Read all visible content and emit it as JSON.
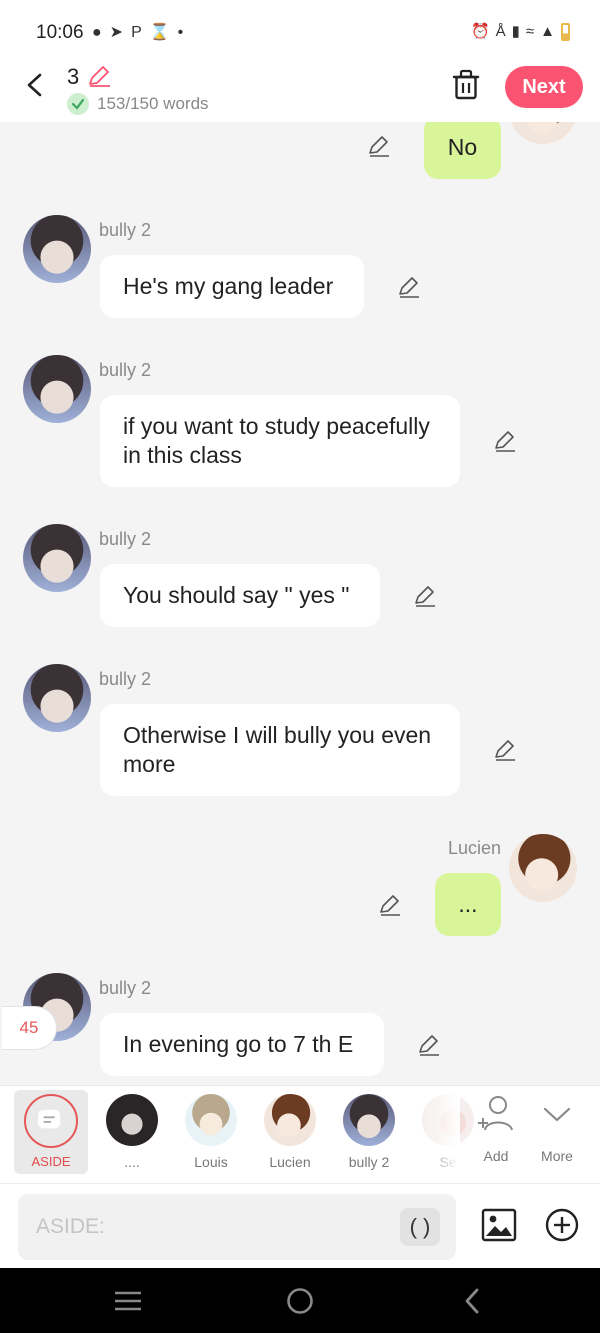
{
  "status_bar": {
    "time": "10:06",
    "left_icons": [
      "chat-bubble-icon",
      "telegram-icon",
      "P",
      "hourglass-icon",
      "dot-icon"
    ],
    "right_icons": [
      "alarm-icon",
      "bluetooth-icon",
      "volte-icon",
      "wifi-icon",
      "signal-icon",
      "battery-icon"
    ]
  },
  "header": {
    "chapter_number": "3",
    "word_count": "153/150 words",
    "next_label": "Next"
  },
  "messages": [
    {
      "sender": "",
      "text": "No",
      "side": "right"
    },
    {
      "sender": "bully 2",
      "text": "He's my gang leader",
      "side": "left"
    },
    {
      "sender": "bully 2",
      "text": "if you want to study peacefully in this class",
      "side": "left"
    },
    {
      "sender": "bully 2",
      "text": "You should say \" yes \"",
      "side": "left"
    },
    {
      "sender": "bully 2",
      "text": "Otherwise I will bully you even more",
      "side": "left"
    },
    {
      "sender": "Lucien",
      "text": "...",
      "side": "right"
    },
    {
      "sender": "bully 2",
      "text": "In evening go to 7 th E",
      "side": "left"
    }
  ],
  "counter_badge": "45",
  "characters": {
    "aside_label": "ASIDE",
    "items": [
      {
        "name": "...."
      },
      {
        "name": "Louis"
      },
      {
        "name": "Lucien"
      },
      {
        "name": "bully 2"
      },
      {
        "name": "Se"
      }
    ],
    "add_label": "Add",
    "more_label": "More"
  },
  "input": {
    "placeholder": "ASIDE:",
    "paren_label": "( )"
  },
  "colors": {
    "accent": "#fb5472",
    "my_bubble": "#d9f59a",
    "aside_red": "#e44b4b"
  }
}
